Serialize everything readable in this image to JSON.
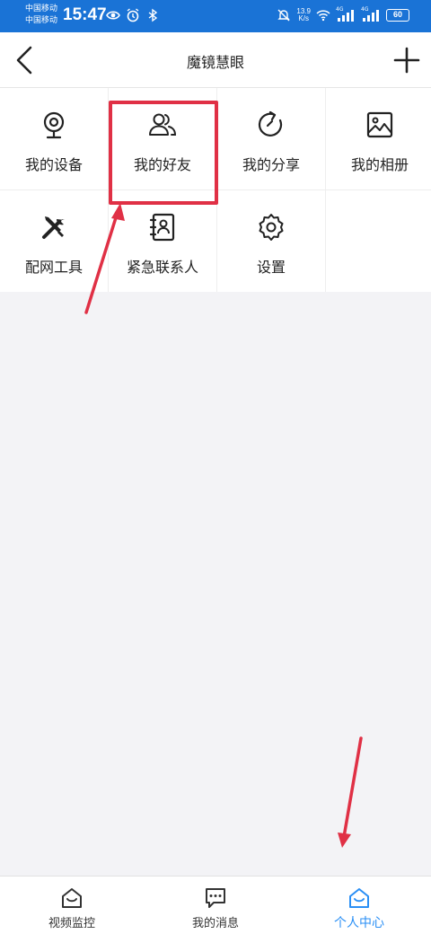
{
  "status_bar": {
    "carrier_1": "中国移动",
    "carrier_2": "中国移动",
    "time": "15:47",
    "net_speed_value": "13.9",
    "net_speed_unit": "K/s",
    "signal_1_label": "4G",
    "signal_2_label": "4G",
    "battery": "60"
  },
  "header": {
    "title": "魔镜慧眼",
    "back_icon": "chevron-left-icon",
    "add_icon": "plus-icon"
  },
  "grid": {
    "items": [
      {
        "label": "我的设备",
        "icon": "webcam-icon"
      },
      {
        "label": "我的好友",
        "icon": "friends-icon"
      },
      {
        "label": "我的分享",
        "icon": "share-icon"
      },
      {
        "label": "我的相册",
        "icon": "album-icon"
      },
      {
        "label": "配网工具",
        "icon": "tools-icon"
      },
      {
        "label": "紧急联系人",
        "icon": "contacts-book-icon"
      },
      {
        "label": "设置",
        "icon": "gear-icon"
      }
    ]
  },
  "tabbar": {
    "tabs": [
      {
        "label": "视频监控",
        "icon": "home-icon",
        "active": false
      },
      {
        "label": "我的消息",
        "icon": "chat-icon",
        "active": false
      },
      {
        "label": "个人中心",
        "icon": "home-icon",
        "active": true
      }
    ]
  },
  "colors": {
    "status_bar": "#1a73d6",
    "accent": "#2a8ff5",
    "annotation": "#e03045"
  }
}
